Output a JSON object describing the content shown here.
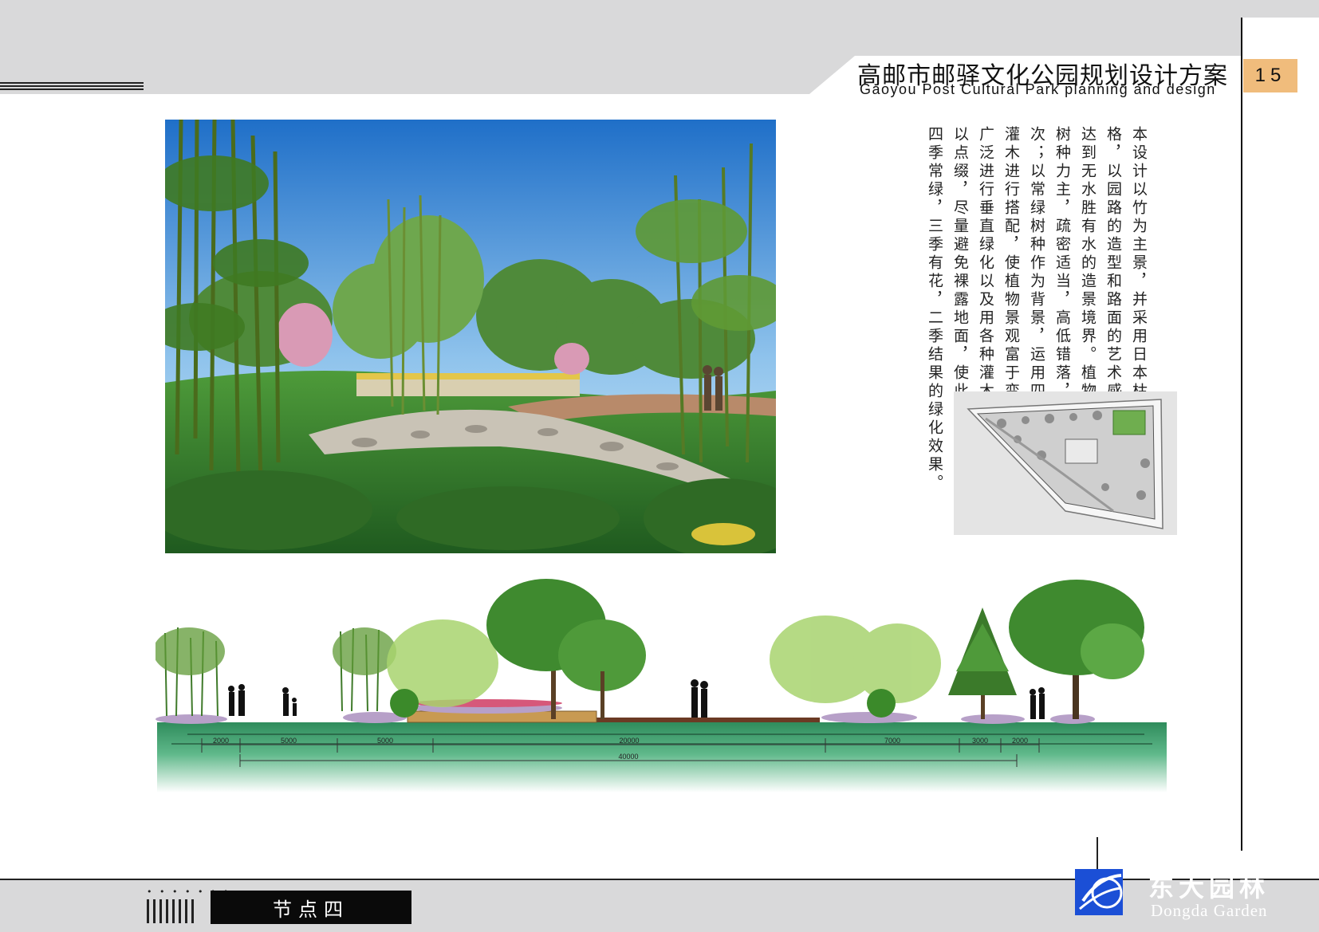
{
  "header": {
    "title_zh": "高邮市邮驿文化公园规划设计方案",
    "title_en": "Gaoyou Post Cultural Park planning and design",
    "page_number": "15"
  },
  "description": "本设计以竹为主景，并采用日本枯山水的园林风格，以园路的造型和路面的艺术感为表达中心，以达到无水胜有水的造景境界。植物配置主要以乡土树种力主，疏密适当，高低错落，形成相对的层次；以常绿树种作为背景，运用四季不同花色的花灌木进行搭配，使植物景观富于变化，色彩丰富。广泛进行垂直绿化以及用各种灌木和草本类花卉加以点缀，尽量避免裸露地面，使此处节点景观达到四季常绿，三季有花，二季结果的绿化效果。",
  "section": {
    "dimensions": [
      "2000",
      "5000",
      "5000",
      "20000",
      "7000",
      "3000",
      "2000"
    ],
    "total": "40000"
  },
  "footer": {
    "section_label": "节点四",
    "logo_zh": "东大园林",
    "logo_en": "Dongda Garden"
  },
  "colors": {
    "header_gray": "#d9d9da",
    "page_tab": "#f0bc7c",
    "logo_blue": "#1b4fd6",
    "ground_green": "#3d9b6b"
  }
}
